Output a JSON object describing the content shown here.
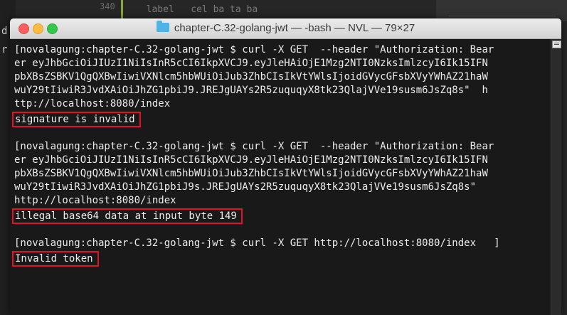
{
  "background": {
    "line_number": "340",
    "code_hint": "  label   cel ba ta ba  ",
    "left_frag_1": "d",
    "left_frag_2": "r"
  },
  "window": {
    "title": "chapter-C.32-golang-jwt — -bash — NVL — 79×27"
  },
  "terminal": {
    "blocks": [
      {
        "lines": [
          "[novalagung:chapter-C.32-golang-jwt $ curl -X GET  --header \"Authorization: Bear",
          "er eyJhbGciOiJIUzI1NiIsInR5cCI6IkpXVCJ9.eyJleHAiOjE1Mzg2NTI0NzksImlzcyI6Ik15IFN",
          "pbXBsZSBKV1QgQXBwIiwiVXNlcm5hbWUiOiJub3ZhbCIsIkVtYWlsIjoidGVycGFsbXVyYWhAZ21haW",
          "wuY29tIiwiR3JvdXAiOiJhZG1pbiJ9.JREJgUAYs2R5zuquqyX8tk23QlajVVe19susm6JsZq8s\"  h",
          "ttp://localhost:8080/index"
        ],
        "output": "signature is invalid"
      },
      {
        "lines": [
          "[novalagung:chapter-C.32-golang-jwt $ curl -X GET  --header \"Authorization: Bear",
          "er eyJhbGciOiJIUzI1NiIsInR5cCI6IkpXVCJ9.eyJleHAiOjE1Mzg2NTI0NzksImlzcyI6Ik15IFN",
          "pbXBsZSBKV1QgQXBwIiwiVXNlcm5hbWUiOiJub3ZhbCIsIkVtYWlsIjoidGVycGFsbXVyYWhAZ21haW",
          "wuY29tIiwiR3JvdXAiOiJhZG1pbiJ9s.JREJgUAYs2R5zuquqyX8tk23QlajVVe19susm6JsZq8s\"",
          "http://localhost:8080/index"
        ],
        "output": "illegal base64 data at input byte 149"
      },
      {
        "lines": [
          "[novalagung:chapter-C.32-golang-jwt $ curl -X GET http://localhost:8080/index   ]"
        ],
        "output": "Invalid token"
      }
    ]
  }
}
